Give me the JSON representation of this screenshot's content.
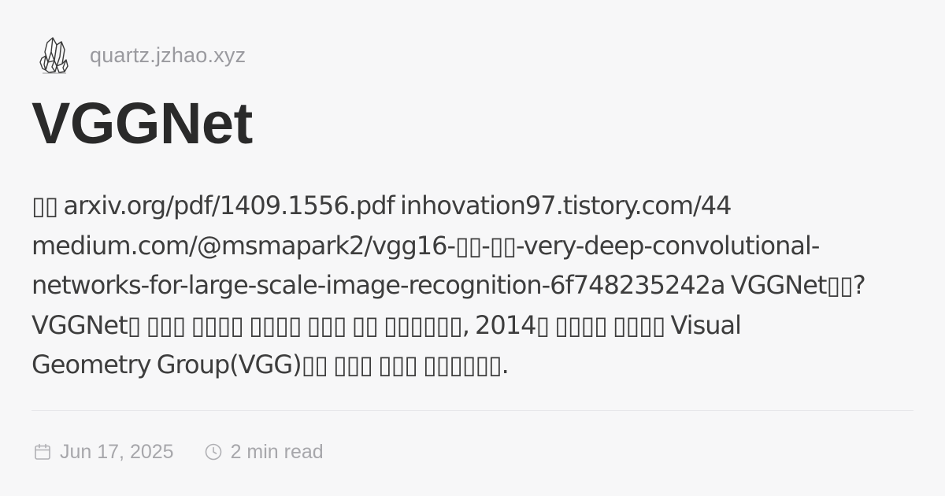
{
  "header": {
    "site_domain": "quartz.jzhao.xyz",
    "logo_icon": "crystal-cluster-icon"
  },
  "page": {
    "title": "VGGNet",
    "excerpt": "▯▯ arxiv.org/pdf/1409.1556.pdf inhovation97.tistory.com/44\nmedium.com/@msmapark2/vgg16-▯▯-▯▯-very-deep-convolutional-\nnetworks-for-large-scale-image-recognition-6f748235242a VGGNet▯▯?\nVGGNet▯ ▯▯▯ ▯▯▯▯ ▯▯▯▯ ▯▯▯ ▯▯ ▯▯▯▯▯▯, 2014▯ ▯▯▯▯ ▯▯▯▯ Visual\nGeometry Group(VGG)▯▯ ▯▯▯ ▯▯▯ ▯▯▯▯▯▯."
  },
  "meta": {
    "date": "Jun 17, 2025",
    "date_icon": "calendar-icon",
    "read_time": "2 min read",
    "read_time_icon": "clock-icon"
  },
  "colors": {
    "background": "#f7f7f8",
    "title": "#2a2a2a",
    "body_text": "#3d3d3d",
    "muted_text": "#a7a7ab",
    "divider": "#e7e7ea"
  }
}
